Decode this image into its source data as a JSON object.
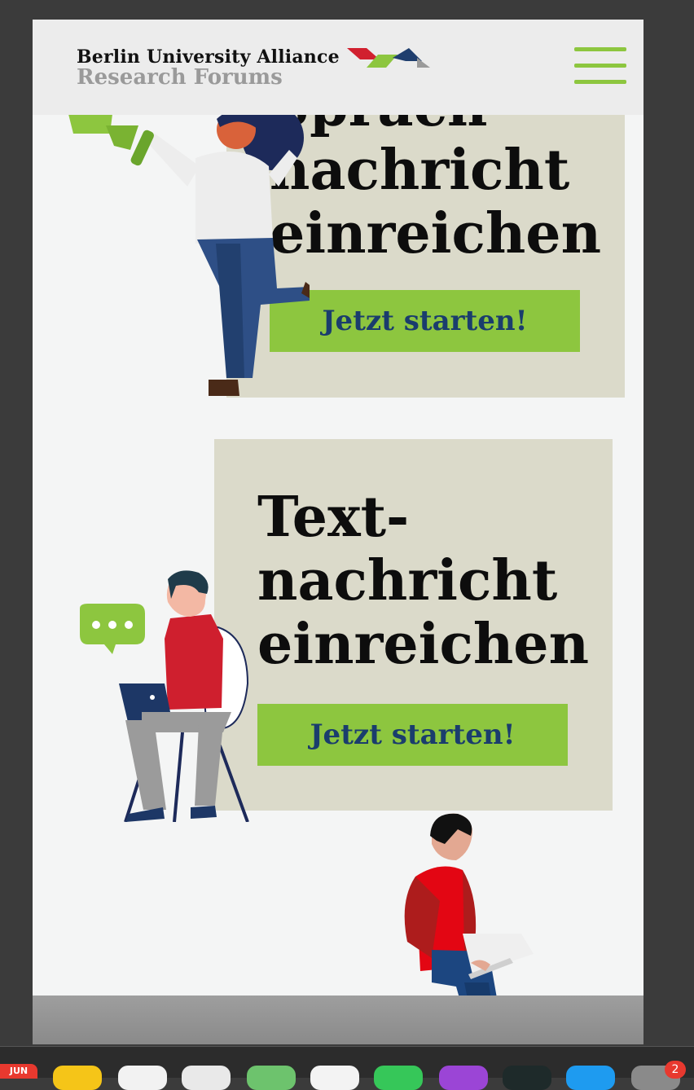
{
  "header": {
    "brand_line1": "Berlin University Alliance",
    "brand_line2": "Research Forums",
    "logo_icon": "bua-logo-icon",
    "menu_icon": "hamburger-menu-icon",
    "accent_color": "#8dc63f"
  },
  "cards": [
    {
      "title_lines": [
        "Sprach-",
        "nachricht",
        "einreichen"
      ],
      "cta_label": "Jetzt starten!",
      "illustration": "woman-with-megaphone-illustration"
    },
    {
      "title_lines": [
        "Text-",
        "nachricht",
        "einreichen"
      ],
      "cta_label": "Jetzt starten!",
      "illustration": "man-with-laptop-chat-bubble-illustration"
    }
  ],
  "bottom_illustration": "man-sitting-with-laptop-illustration",
  "dock": {
    "calendar_month": "JUN",
    "badge_count": "2"
  },
  "colors": {
    "card_bg": "#dbdaca",
    "button_bg": "#8dc63f",
    "button_text": "#1a3d6d"
  }
}
